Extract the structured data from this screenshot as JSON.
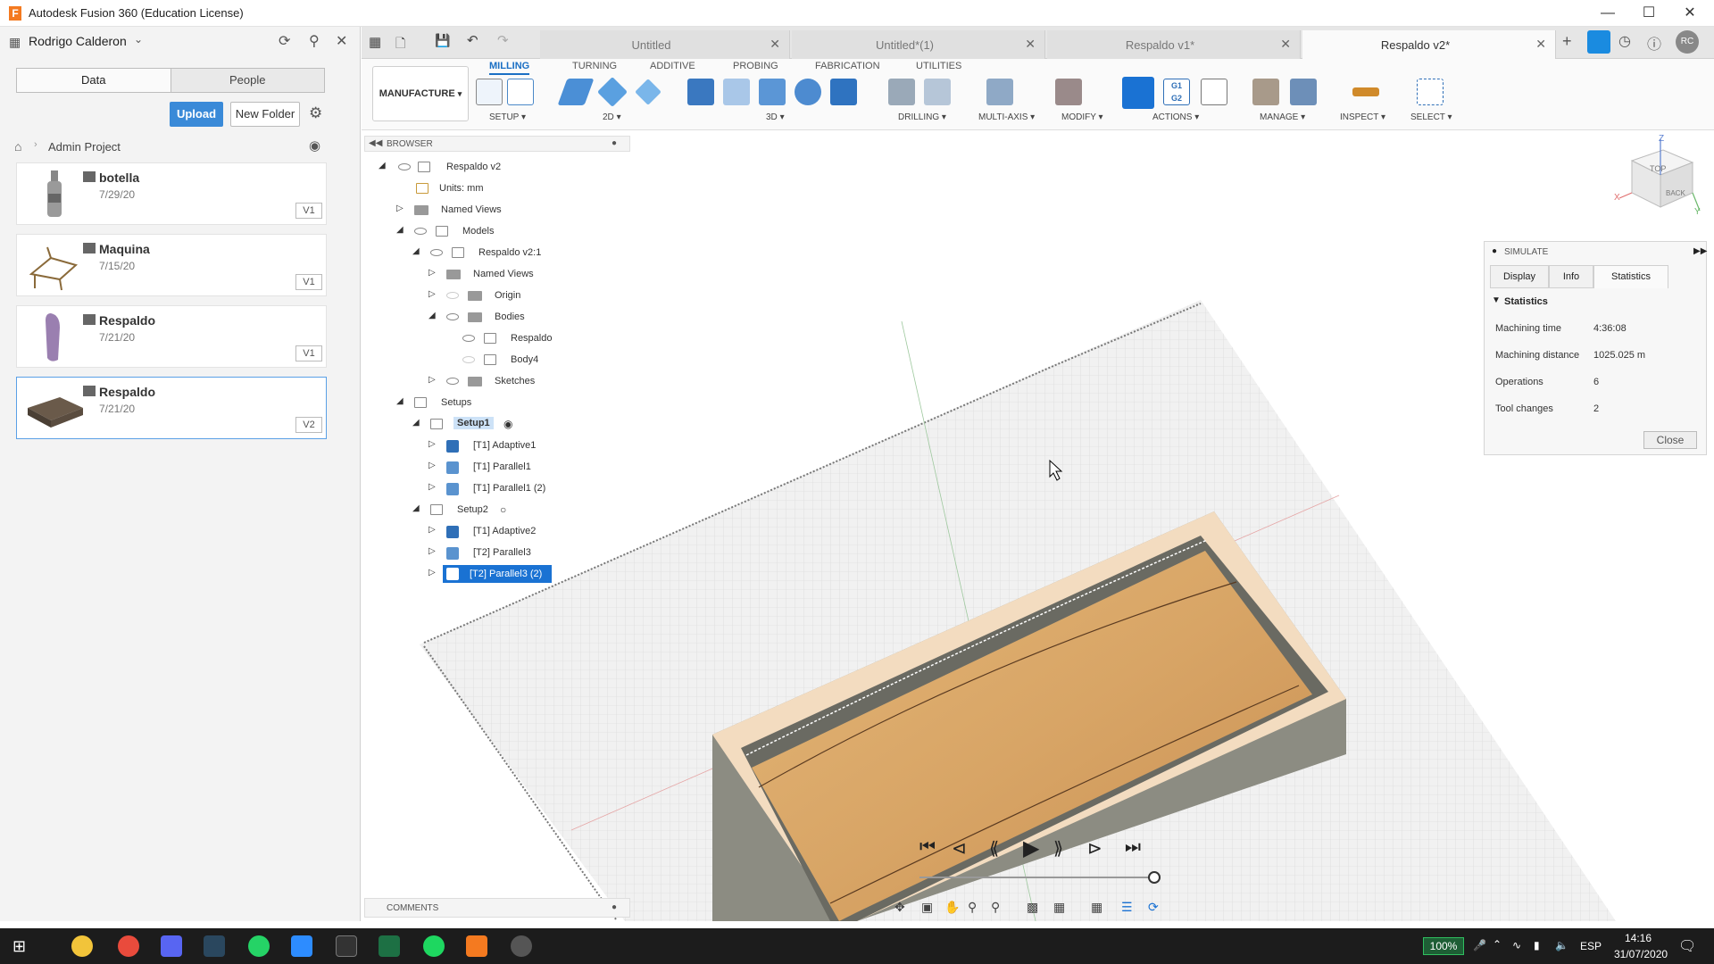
{
  "window": {
    "title": "Autodesk Fusion 360 (Education License)",
    "app_icon_letter": "F"
  },
  "user": {
    "name": "Rodrigo Calderon",
    "initials": "RC"
  },
  "data_panel": {
    "tabs": [
      "Data",
      "People"
    ],
    "upload_label": "Upload",
    "new_folder_label": "New Folder",
    "breadcrumb": "Admin Project",
    "files": [
      {
        "name": "botella",
        "date": "7/29/20",
        "version": "V1"
      },
      {
        "name": "Maquina",
        "date": "7/15/20",
        "version": "V1"
      },
      {
        "name": "Respaldo",
        "date": "7/21/20",
        "version": "V1"
      },
      {
        "name": "Respaldo",
        "date": "7/21/20",
        "version": "V2"
      }
    ]
  },
  "doc_tabs": [
    {
      "label": "Untitled"
    },
    {
      "label": "Untitled*(1)"
    },
    {
      "label": "Respaldo v1*"
    },
    {
      "label": "Respaldo v2*"
    }
  ],
  "ribbon": {
    "workspace": "MANUFACTURE",
    "tabs": [
      "MILLING",
      "TURNING",
      "ADDITIVE",
      "PROBING",
      "FABRICATION",
      "UTILITIES"
    ],
    "groups": [
      "SETUP",
      "2D",
      "3D",
      "DRILLING",
      "MULTI-AXIS",
      "MODIFY",
      "ACTIONS",
      "MANAGE",
      "INSPECT",
      "SELECT"
    ]
  },
  "browser": {
    "title": "BROWSER",
    "root": "Respaldo v2",
    "units": "Units: mm",
    "named_views": "Named Views",
    "models": "Models",
    "component": "Respaldo v2:1",
    "named_views_2": "Named Views",
    "origin": "Origin",
    "bodies": "Bodies",
    "body1": "Respaldo",
    "body2": "Body4",
    "sketches": "Sketches",
    "setups": "Setups",
    "setup1": "Setup1",
    "ops1": [
      "[T1] Adaptive1",
      "[T1] Parallel1",
      "[T1] Parallel1 (2)"
    ],
    "setup2": "Setup2",
    "ops2": [
      "[T1] Adaptive2",
      "[T2] Parallel3",
      "[T2] Parallel3 (2)"
    ]
  },
  "simulate": {
    "title": "SIMULATE",
    "tabs": [
      "Display",
      "Info",
      "Statistics"
    ],
    "section": "Statistics",
    "stats": [
      {
        "label": "Machining time",
        "value": "4:36:08"
      },
      {
        "label": "Machining distance",
        "value": "1025.025 m"
      },
      {
        "label": "Operations",
        "value": "6"
      },
      {
        "label": "Tool changes",
        "value": "2"
      }
    ],
    "close_label": "Close"
  },
  "comments_label": "COMMENTS",
  "viewcube": {
    "top": "TOP",
    "back": "BACK",
    "z": "Z",
    "x": "X",
    "y": "Y"
  },
  "taskbar": {
    "battery": "100%",
    "lang": "ESP",
    "time": "14:16",
    "date": "31/07/2020"
  },
  "colors": {
    "accent": "#1a72d3",
    "stock": "#e8c592",
    "wood": "#d9a967"
  }
}
